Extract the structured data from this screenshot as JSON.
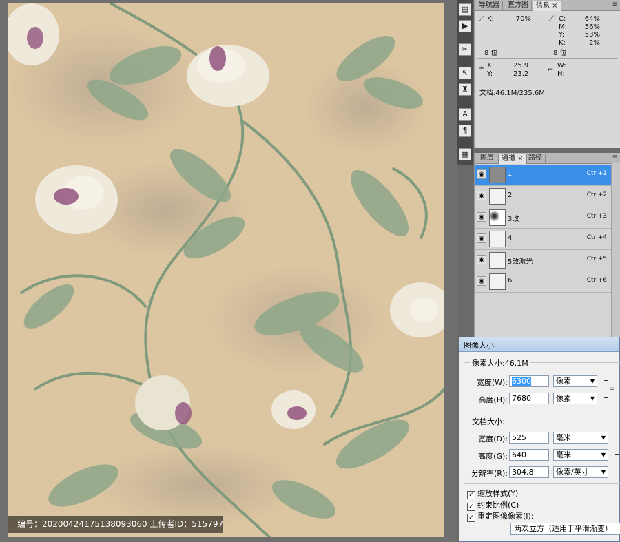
{
  "watermark": {
    "text": "编号：20200424175138093060 上传者ID：515797"
  },
  "colors": {
    "canvas_bg": "#d9c4a0",
    "leaf_green": "#7f9a7c",
    "flower_purple": "#8c4a78",
    "selection_blue": "#3a8fe8"
  },
  "tools": [
    "histogram-icon",
    "play-icon",
    "scissors-icon",
    "cursor-icon",
    "stamp-icon",
    "text-icon",
    "paragraph-icon",
    "layers-icon"
  ],
  "info_panel": {
    "tabs": [
      "导航器",
      "直方图",
      "信息 ×"
    ],
    "active_tab": 2,
    "k_label": "K:",
    "k_value": "70%",
    "bit_left": "8 位",
    "c_label": "C:",
    "c_value": "64%",
    "m_label": "M:",
    "m_value": "56%",
    "y_label": "Y:",
    "y_value": "53%",
    "k2_label": "K:",
    "k2_value": "2%",
    "bit_right": "8 位",
    "x_label": "X:",
    "x_value": "25.9",
    "y_coord_label": "Y:",
    "y_coord_value": "23.2",
    "w_label": "W:",
    "h_label": "H:",
    "doc_info": "文档:46.1M/235.6M",
    "menu_icon": "≡"
  },
  "channels_panel": {
    "tabs": [
      "图层",
      "通道 ×",
      "路径"
    ],
    "active_tab": 1,
    "menu_icon": "≡",
    "channels": [
      {
        "name": "1",
        "shortcut": "Ctrl+1",
        "selected": true
      },
      {
        "name": "2",
        "shortcut": "Ctrl+2",
        "selected": false
      },
      {
        "name": "3改",
        "shortcut": "Ctrl+3",
        "selected": false
      },
      {
        "name": "4",
        "shortcut": "Ctrl+4",
        "selected": false
      },
      {
        "name": "5改激光",
        "shortcut": "Ctrl+5",
        "selected": false
      },
      {
        "name": "6",
        "shortcut": "Ctrl+6",
        "selected": false
      }
    ]
  },
  "image_size_dialog": {
    "title": "图像大小",
    "pixel_dimensions_label": "像素大小:46.1M",
    "width_label": "宽度(W):",
    "width_value": "6300",
    "width_unit": "像素",
    "height_label": "高度(H):",
    "height_value": "7680",
    "height_unit": "像素",
    "doc_size_label": "文档大小:",
    "doc_width_label": "宽度(D):",
    "doc_width_value": "525",
    "doc_width_unit": "毫米",
    "doc_height_label": "高度(G):",
    "doc_height_value": "640",
    "doc_height_unit": "毫米",
    "resolution_label": "分辨率(R):",
    "resolution_value": "304.8",
    "resolution_unit": "像素/英寸",
    "scale_styles_label": "缩放样式(Y)",
    "constrain_label": "约束比例(C)",
    "resample_label": "重定图像像素(I):",
    "resample_method": "两次立方（适用于平滑渐变）",
    "check_mark": "✓"
  }
}
